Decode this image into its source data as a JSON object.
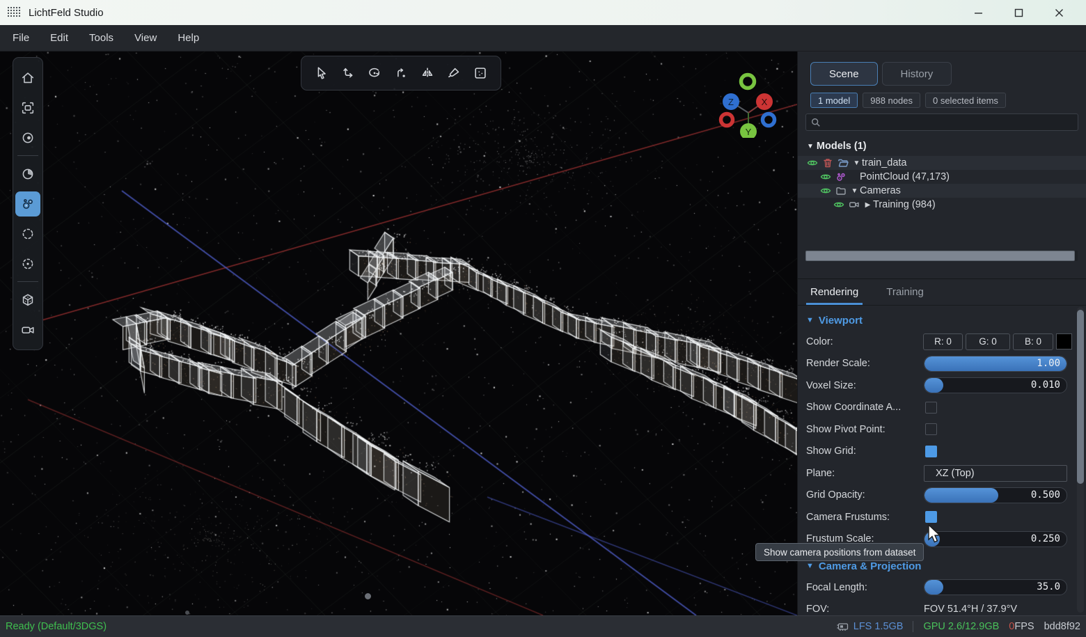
{
  "window": {
    "title": "LichtFeld Studio",
    "minimize": "minimize",
    "maximize": "maximize",
    "close": "close"
  },
  "menu": {
    "items": [
      "File",
      "Edit",
      "Tools",
      "View",
      "Help"
    ]
  },
  "viewport": {
    "left_toolbar": [
      "home",
      "frame-focus",
      "toggle-visibility",
      "time-pie",
      "point-cloud",
      "selection-circle",
      "selection-radius",
      "bounding-box",
      "camera-view"
    ],
    "left_toolbar_active": "point-cloud",
    "top_toolbar": [
      "select-pointer",
      "move-tool",
      "rotate-tool",
      "path-tool",
      "mirror-tool",
      "brush-tool",
      "marquee-tool"
    ],
    "gizmo": {
      "axis_x": "X",
      "axis_y": "Y",
      "axis_z": "Z"
    }
  },
  "scene_panel": {
    "tabs": [
      {
        "label": "Scene",
        "active": true
      },
      {
        "label": "History",
        "active": false
      }
    ],
    "badges": [
      {
        "label": "1 model",
        "accent": true
      },
      {
        "label": "988 nodes",
        "accent": false
      },
      {
        "label": "0 selected items",
        "accent": false
      }
    ],
    "search": {
      "value": "",
      "placeholder": ""
    },
    "tree_header": {
      "caret": "▼",
      "label": "Models (1)"
    },
    "tree": [
      {
        "indent": 0,
        "stripe": true,
        "icons": [
          "eye",
          "trash",
          "folder-open"
        ],
        "caret": "▼",
        "label": "train_data"
      },
      {
        "indent": 1,
        "stripe": false,
        "icons": [
          "eye",
          "pointcloud"
        ],
        "caret": "",
        "label": "PointCloud (47,173)"
      },
      {
        "indent": 1,
        "stripe": true,
        "icons": [
          "eye",
          "folder"
        ],
        "caret": "▼",
        "label": "Cameras"
      },
      {
        "indent": 2,
        "stripe": false,
        "icons": [
          "eye",
          "videocam"
        ],
        "caret": "▶",
        "label": "Training (984)"
      }
    ]
  },
  "properties_panel": {
    "tabs": [
      {
        "label": "Rendering",
        "active": true
      },
      {
        "label": "Training",
        "active": false
      }
    ],
    "rows": [
      {
        "type": "header",
        "label": "Viewport",
        "caret": "▼"
      },
      {
        "type": "color",
        "label": "Color:",
        "r": "R: 0",
        "g": "G: 0",
        "b": "B: 0",
        "swatch": "#000000"
      },
      {
        "type": "slider",
        "label": "Render Scale:",
        "value": "1.00",
        "fill": 100
      },
      {
        "type": "slider",
        "label": "Voxel Size:",
        "value": "0.010",
        "fill": 13
      },
      {
        "type": "checkbox",
        "label": "Show Coordinate A...",
        "checked": false
      },
      {
        "type": "checkbox",
        "label": "Show Pivot Point:",
        "checked": false
      },
      {
        "type": "checkbox",
        "label": "Show Grid:",
        "checked": true
      },
      {
        "type": "dropdown",
        "label": "Plane:",
        "value": "XZ (Top)"
      },
      {
        "type": "slider",
        "label": "Grid Opacity:",
        "value": "0.500",
        "fill": 52
      },
      {
        "type": "checkbox",
        "label": "Camera Frustums:",
        "checked": true
      },
      {
        "type": "slider",
        "label": "Frustum Scale:",
        "value": "0.250",
        "fill": 11
      },
      {
        "type": "header",
        "label": "Camera & Projection",
        "caret": "▼"
      },
      {
        "type": "slider",
        "label": "Focal Length:",
        "value": "35.0",
        "fill": 13
      },
      {
        "type": "text",
        "label": "FOV:",
        "value": "FOV 51.4°H / 37.9°V"
      }
    ]
  },
  "tooltip": "Show camera positions from dataset",
  "status_bar": {
    "ready": "Ready (Default/3DGS)",
    "lfs": "LFS 1.5GB",
    "gpu": "GPU 2.6/12.9GB",
    "fps_zero": "0",
    "fps_label": "FPS",
    "hash": "bdd8f92"
  },
  "colors": {
    "accent_blue": "#4a8fd5",
    "axis_red": "#c23c3c",
    "axis_blue": "#3c50c2",
    "grid_line": "#8a9c8a",
    "star": "#ffffff",
    "box_edge": "#f2f4f6",
    "status_green": "#3fbf4f"
  }
}
